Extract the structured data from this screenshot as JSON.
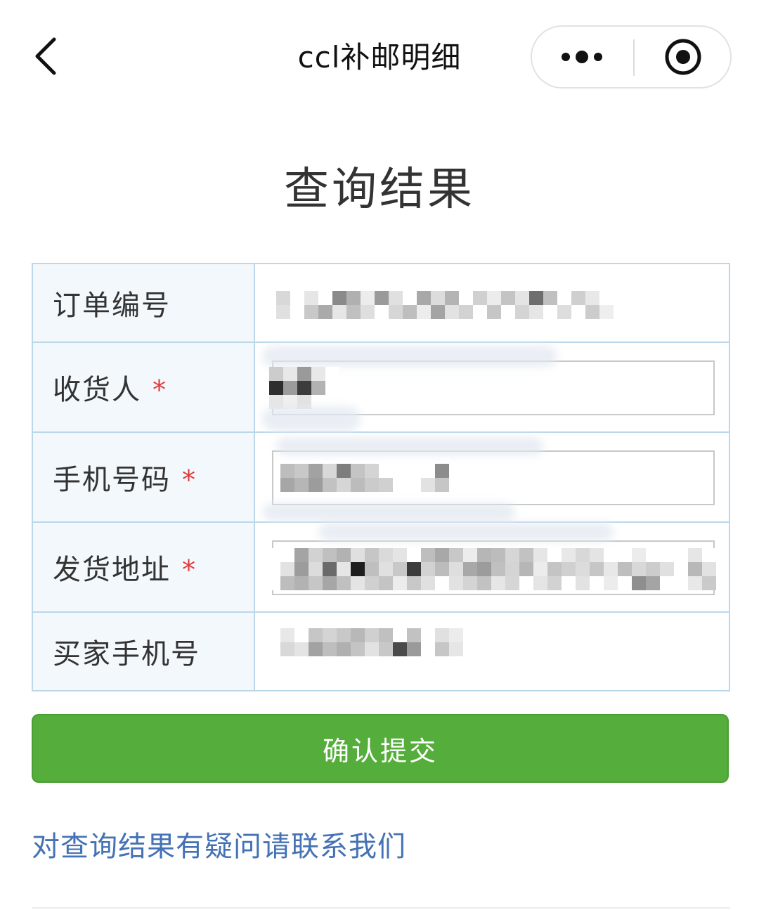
{
  "nav": {
    "title": "ccl补邮明细",
    "back_icon": "chevron-left-icon",
    "more_icon": "more-dots-icon",
    "close_icon": "target-close-icon"
  },
  "page": {
    "title": "查询结果"
  },
  "form": {
    "rows": [
      {
        "label": "订单编号",
        "required": false,
        "value_type": "static"
      },
      {
        "label": "收货人",
        "required": true,
        "value_type": "input"
      },
      {
        "label": "手机号码",
        "required": true,
        "value_type": "input"
      },
      {
        "label": "发货地址",
        "required": true,
        "value_type": "input"
      },
      {
        "label": "买家手机号",
        "required": false,
        "value_type": "static"
      }
    ],
    "required_mark": "*"
  },
  "actions": {
    "submit_label": "确认提交",
    "contact_label": "对查询结果有疑问请联系我们"
  },
  "colors": {
    "submit_bg": "#55ad3b",
    "link": "#4472b4",
    "required": "#e03a3a",
    "table_border": "#bcd7ea",
    "label_bg": "#f3f8fd"
  }
}
